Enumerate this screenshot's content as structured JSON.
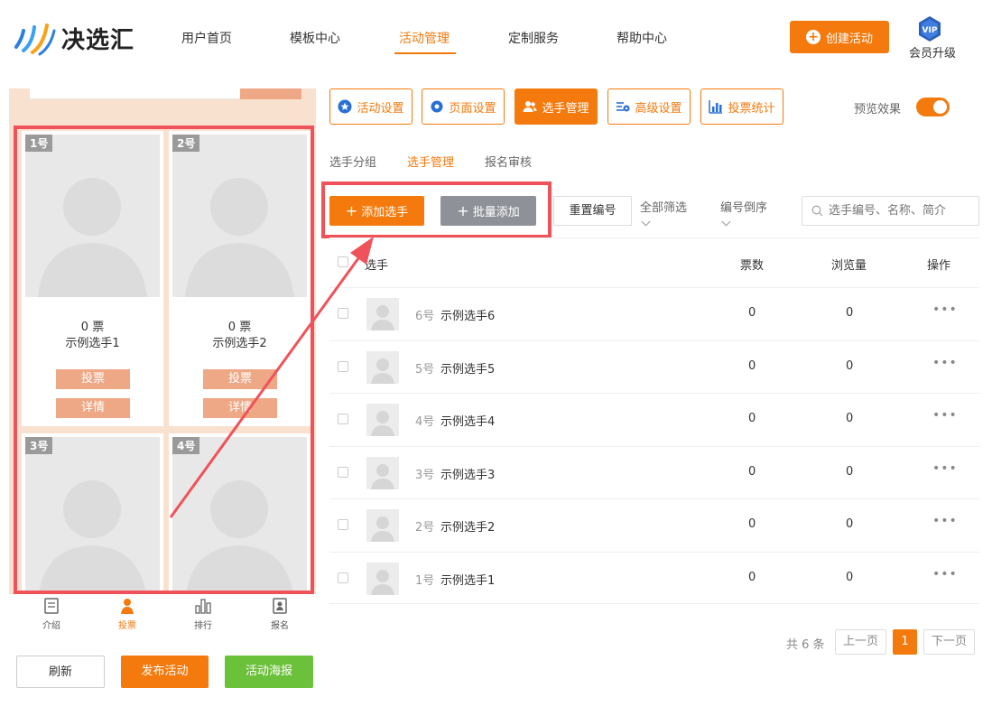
{
  "brand": {
    "name": "决选汇",
    "accent": "#f47a0d",
    "highlight": "#f0525a"
  },
  "nav": {
    "items": [
      {
        "label": "用户首页"
      },
      {
        "label": "模板中心"
      },
      {
        "label": "活动管理",
        "active": true
      },
      {
        "label": "定制服务"
      },
      {
        "label": "帮助中心"
      }
    ],
    "create_label": "创建活动",
    "vip_badge": "VIP",
    "vip_label": "会员升级"
  },
  "preview": {
    "cards": [
      {
        "num": "1号",
        "votes": "0 票",
        "name": "示例选手1"
      },
      {
        "num": "2号",
        "votes": "0 票",
        "name": "示例选手2"
      },
      {
        "num": "3号"
      },
      {
        "num": "4号"
      }
    ],
    "vote_label": "投票",
    "detail_label": "详情",
    "tabs": [
      {
        "label": "介绍",
        "icon": "document-icon"
      },
      {
        "label": "投票",
        "icon": "person-icon",
        "active": true
      },
      {
        "label": "排行",
        "icon": "ranking-icon"
      },
      {
        "label": "报名",
        "icon": "signup-icon"
      }
    ],
    "refresh_label": "刷新",
    "publish_label": "发布活动",
    "poster_label": "活动海报"
  },
  "toolbar": {
    "buttons": [
      {
        "label": "活动设置",
        "icon": "star-circle-icon"
      },
      {
        "label": "页面设置",
        "icon": "gear-icon"
      },
      {
        "label": "选手管理",
        "icon": "users-icon",
        "active": true
      },
      {
        "label": "高级设置",
        "icon": "sliders-icon"
      },
      {
        "label": "投票统计",
        "icon": "bar-chart-icon"
      }
    ],
    "preview_label": "预览效果",
    "preview_on": true
  },
  "subtabs": [
    {
      "label": "选手分组"
    },
    {
      "label": "选手管理",
      "active": true
    },
    {
      "label": "报名审核"
    }
  ],
  "actions": {
    "add_label": "添加选手",
    "batch_label": "批量添加",
    "reset_label": "重置编号",
    "filter_label": "全部筛选",
    "sort_label": "编号倒序",
    "search_placeholder": "选手编号、名称、简介"
  },
  "table": {
    "headers": {
      "player": "选手",
      "votes": "票数",
      "views": "浏览量",
      "ops": "操作"
    },
    "rows": [
      {
        "num": "6号",
        "name": "示例选手6",
        "votes": "0",
        "views": "0"
      },
      {
        "num": "5号",
        "name": "示例选手5",
        "votes": "0",
        "views": "0"
      },
      {
        "num": "4号",
        "name": "示例选手4",
        "votes": "0",
        "views": "0"
      },
      {
        "num": "3号",
        "name": "示例选手3",
        "votes": "0",
        "views": "0"
      },
      {
        "num": "2号",
        "name": "示例选手2",
        "votes": "0",
        "views": "0"
      },
      {
        "num": "1号",
        "name": "示例选手1",
        "votes": "0",
        "views": "0"
      }
    ],
    "more_glyph": "•••"
  },
  "pagination": {
    "total": "共 6 条",
    "prev": "上一页",
    "current": "1",
    "next": "下一页"
  }
}
